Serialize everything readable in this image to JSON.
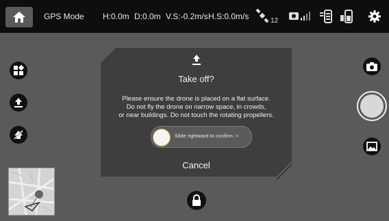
{
  "top_bar": {
    "mode": "GPS Mode",
    "height": "H:0.0m",
    "distance": "D:0.0m",
    "vertical_speed": "V.S:-0.2m/s",
    "horizontal_speed": "H.S:0.0m/s",
    "satellite_count": "12",
    "icons": [
      "home-icon",
      "satellite-icon",
      "camera-signal-icon",
      "remote-controller-icon",
      "battery-icon",
      "settings-gear-icon"
    ]
  },
  "left_controls": [
    "intelligent-flight-icon",
    "takeoff-icon",
    "return-home-icon"
  ],
  "right_controls": [
    "camera-switch-icon",
    "shutter-button",
    "gallery-icon"
  ],
  "dialog": {
    "icon": "takeoff-icon",
    "title": "Take off?",
    "message_line1": "Please ensure the drone is placed on a flat surface.",
    "message_line2": "Do not fly the drone on narrow space, in crowds,",
    "message_line3": "or near buildings. Do not touch the rotating propellers.",
    "slider_label": "Slide rightward to confirm. >",
    "cancel_label": "Cancel"
  },
  "bottom": {
    "lock_icon": "lock-icon",
    "minimap_icon": "map-icon"
  }
}
